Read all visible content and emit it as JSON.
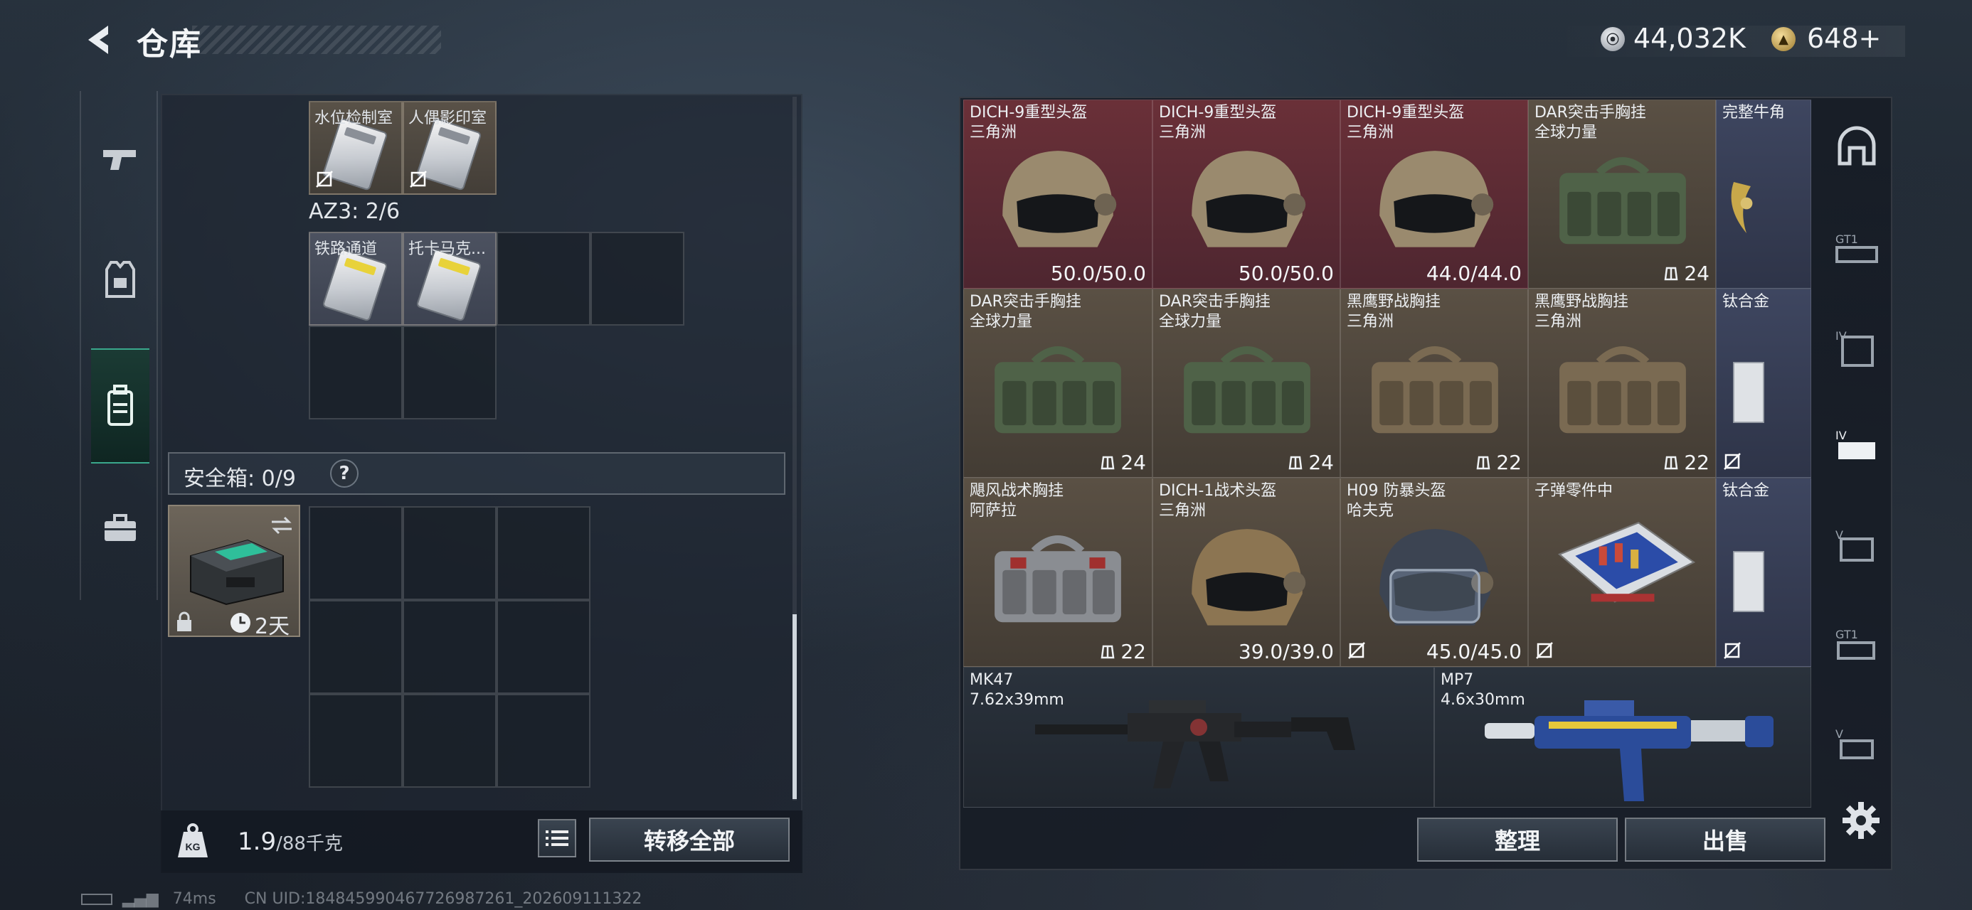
{
  "header": {
    "title": "仓库",
    "currency": [
      {
        "icon": "silver-coin-icon",
        "value": "44,032K"
      },
      {
        "icon": "gold-coin-icon",
        "value": "648",
        "suffix": "+"
      }
    ]
  },
  "left_nav": {
    "items": [
      {
        "name": "weapon-tab",
        "icon": "pistol-icon",
        "active": false
      },
      {
        "name": "armor-tab",
        "icon": "vest-icon",
        "active": false
      },
      {
        "name": "backpack-tab",
        "icon": "backpack-icon",
        "active": true
      },
      {
        "name": "case-tab",
        "icon": "briefcase-icon",
        "active": false
      }
    ]
  },
  "container": {
    "top_items": [
      {
        "label": "水位检制室",
        "kind": "keycard"
      },
      {
        "label": "人偶影印室",
        "kind": "keycard"
      }
    ],
    "az3_label": "AZ3: 2/6",
    "az3_items": [
      {
        "label": "铁路通道",
        "kind": "keycard-yellow"
      },
      {
        "label": "托卡马克...",
        "kind": "keycard-yellow"
      }
    ],
    "safe_label": "安全箱: 0/9",
    "safe_help": "?",
    "safe_timer": "2天"
  },
  "bottom_left": {
    "weight_value": "1.9",
    "weight_max": "/88千克",
    "transfer_all": "转移全部"
  },
  "stash": {
    "rows": [
      [
        {
          "name": "DICH-9重型头盔",
          "sub": "三角洲",
          "value": "50.0/50.0",
          "color": "red",
          "item": "helmet-tan"
        },
        {
          "name": "DICH-9重型头盔",
          "sub": "三角洲",
          "value": "50.0/50.0",
          "color": "red",
          "item": "helmet-tan"
        },
        {
          "name": "DICH-9重型头盔",
          "sub": "三角洲",
          "value": "44.0/44.0",
          "color": "red",
          "item": "helmet-tan"
        },
        {
          "name": "DAR突击手胸挂",
          "sub": "全球力量",
          "value": "24",
          "color": "tan",
          "item": "rig-green",
          "slots": true
        },
        {
          "name": "完整牛角",
          "sub": "",
          "value": "",
          "color": "blue",
          "item": "horn"
        }
      ],
      [
        {
          "name": "DAR突击手胸挂",
          "sub": "全球力量",
          "value": "24",
          "color": "tan",
          "item": "rig-green",
          "slots": true
        },
        {
          "name": "DAR突击手胸挂",
          "sub": "全球力量",
          "value": "24",
          "color": "tan",
          "item": "rig-green",
          "slots": true
        },
        {
          "name": "黑鹰野战胸挂",
          "sub": "三角洲",
          "value": "22",
          "color": "tan",
          "item": "rig-tan",
          "slots": true
        },
        {
          "name": "黑鹰野战胸挂",
          "sub": "三角洲",
          "value": "22",
          "color": "tan",
          "item": "rig-tan",
          "slots": true
        },
        {
          "name": "钛合金",
          "sub": "",
          "value": "",
          "color": "blue",
          "item": "plate",
          "nolink": true
        }
      ],
      [
        {
          "name": "飓风战术胸挂",
          "sub": "阿萨拉",
          "value": "22",
          "color": "tan",
          "item": "rig-gray",
          "slots": true
        },
        {
          "name": "DICH-1战术头盔",
          "sub": "三角洲",
          "value": "39.0/39.0",
          "color": "tan",
          "item": "helmet-khaki"
        },
        {
          "name": "H09 防暴头盔",
          "sub": "哈夫克",
          "value": "45.0/45.0",
          "color": "tan",
          "item": "helmet-riot",
          "nolink": true
        },
        {
          "name": "子弹零件中",
          "sub": "",
          "value": "",
          "color": "tan",
          "item": "ammo-box",
          "nolink": true
        },
        {
          "name": "钛合金",
          "sub": "",
          "value": "",
          "color": "blue",
          "item": "plate",
          "nolink": true
        }
      ]
    ],
    "weapons": [
      {
        "name": "MK47",
        "caliber": "7.62x39mm"
      },
      {
        "name": "MP7",
        "caliber": "4.6x30mm"
      }
    ]
  },
  "bottom_right": {
    "organize": "整理",
    "sell": "出售"
  },
  "right_nav": {
    "items": [
      "helmet-slot-icon",
      "gt1-rig-icon",
      "iv-armor-icon",
      "iv-vest-icon",
      "v-armor-icon",
      "gt1-vest-icon",
      "v-rig-icon"
    ]
  },
  "status": {
    "ping": "74ms",
    "uid": "CN UID:18484599046772698726​1_202609111322"
  },
  "colors": {
    "red_tile": "#6a3038",
    "tan_tile": "#5a5044",
    "blue_tile": "#3e4660",
    "accent": "#3aa88c"
  }
}
